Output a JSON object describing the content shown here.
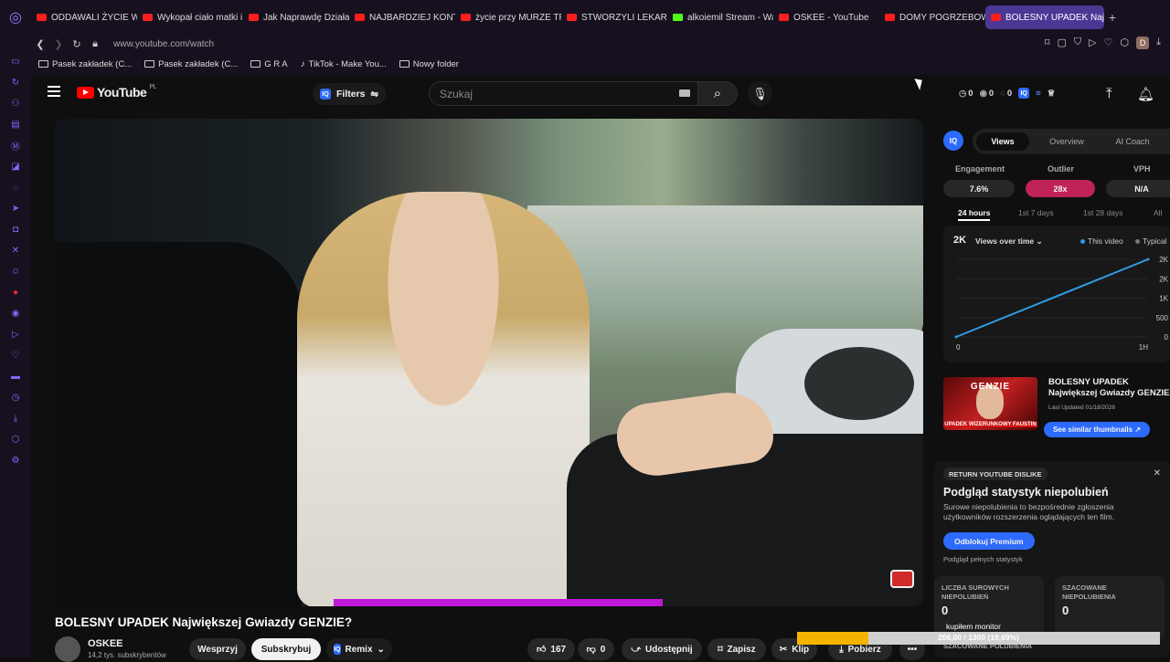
{
  "tabs": [
    {
      "label": "ODDAWALI ŻYCIE W I",
      "icon": "youtube-icon"
    },
    {
      "label": "Wykopał ciało matki i",
      "icon": "youtube-icon"
    },
    {
      "label": "Jak Naprawdę Działa",
      "icon": "youtube-icon"
    },
    {
      "label": "NAJBARDZIEJ KONTR",
      "icon": "youtube-icon"
    },
    {
      "label": "życie przy MURZE TR",
      "icon": "youtube-icon"
    },
    {
      "label": "STWORZYLI LEKARZ",
      "icon": "youtube-icon"
    },
    {
      "label": "alkoiemil Stream - Wa",
      "icon": "kick-icon"
    },
    {
      "label": "OSKEE - YouTube",
      "icon": "youtube-icon"
    },
    {
      "label": "DOMY POGRZEBOWE",
      "icon": "youtube-icon"
    },
    {
      "label": "BOLESNY UPADEK Naj",
      "icon": "youtube-icon",
      "active": true
    }
  ],
  "address": {
    "url": "www.youtube.com/watch",
    "profile_initial": "D"
  },
  "bookmarks": [
    {
      "label": "Pasek zakładek (C...",
      "icon": "folder-icon"
    },
    {
      "label": "Pasek zakładek (C...",
      "icon": "folder-icon"
    },
    {
      "label": "G R A",
      "icon": "folder-icon"
    },
    {
      "label": "TikTok - Make You...",
      "icon": "tiktok-icon"
    },
    {
      "label": "Nowy folder",
      "icon": "folder-icon"
    }
  ],
  "header": {
    "logo_text": "YouTube",
    "logo_region": "PL",
    "filters_label": "Filters",
    "filters_badge": "IQ",
    "search_placeholder": "Szukaj",
    "stats": [
      {
        "icon": "clock-icon",
        "value": "0"
      },
      {
        "icon": "eye-icon",
        "value": "0"
      },
      {
        "icon": "eye-off-icon",
        "value": "0"
      }
    ]
  },
  "video": {
    "title": "BOLESNY UPADEK Największej Gwiazdy GENZIE?",
    "channel": "OSKEE",
    "subscribers": "14,2 tys. subskrybentów",
    "support_label": "Wesprzyj",
    "subscribe_label": "Subskrybuj",
    "remix_label": "Remix",
    "likes": "167",
    "dislikes": "0",
    "share_label": "Udostępnij",
    "save_label": "Zapisz",
    "clip_label": "Klip",
    "download_label": "Pobierz",
    "more_label": "•••"
  },
  "vidiq": {
    "badge": "IQ",
    "tabs": [
      "Views",
      "Overview",
      "AI Coach"
    ],
    "active_tab": "Views",
    "metrics": [
      {
        "label": "Engagement",
        "value": "7.6%"
      },
      {
        "label": "Outlier",
        "value": "28x"
      },
      {
        "label": "VPH",
        "value": "N/A"
      }
    ],
    "periods": [
      "24 hours",
      "1st 7 days",
      "1st 28 days",
      "All"
    ],
    "active_period": "24 hours",
    "views_count": "2K",
    "mode_label": "Views over time",
    "legend_this": "This video",
    "legend_typical": "Typical",
    "thumb_title": "BOLESNY UPADEK Największej Gwiazdy GENZIE?",
    "last_updated": "Last Updated 01/18/2026",
    "thumb_top": "GENZIE",
    "thumb_bottom": "UPADEK WIZERUNKOWY FAUSTIN",
    "similar_label": "See similar thumbnails ↗"
  },
  "chart_data": {
    "type": "line",
    "x": [
      "0",
      "1H"
    ],
    "series": [
      {
        "name": "This video",
        "values": [
          0,
          2000
        ]
      }
    ],
    "yticks": [
      "0",
      "500",
      "1K",
      "2K",
      "2K"
    ],
    "ylim": [
      0,
      2000
    ],
    "xlabel": "",
    "ylabel": "",
    "grid": true,
    "colors": {
      "this_video": "#2f9de4",
      "typical": "#777777"
    }
  },
  "ryd": {
    "tag": "RETURN YOUTUBE DISLIKE",
    "heading": "Podgląd statystyk niepolubień",
    "description": "Surowe niepolubienia to bezpośrednie zgłoszenia użytkowników rozszerzenia oglądających ten film.",
    "unlock_label": "Odblokuj Premium",
    "full_stats_link": "Podgląd pełnych statystyk",
    "raw_label": "LICZBA SUROWYCH NIEPOLUBIEŃ",
    "raw_value": "0",
    "est_label": "SZACOWANE NIEPOLUBIENIA",
    "est_value": "0",
    "est_sub": "SZACOWANE POLUBIENIA"
  },
  "monitor": {
    "label": "kupiłem monitor",
    "value": "256,00 / 1300 (19,69%)",
    "fraction": 0.1969
  },
  "colors": {
    "accent": "#2d6bff",
    "youtube_red": "#ff0000",
    "outlier": "#bf2357",
    "tab_active": "#4b3794"
  }
}
